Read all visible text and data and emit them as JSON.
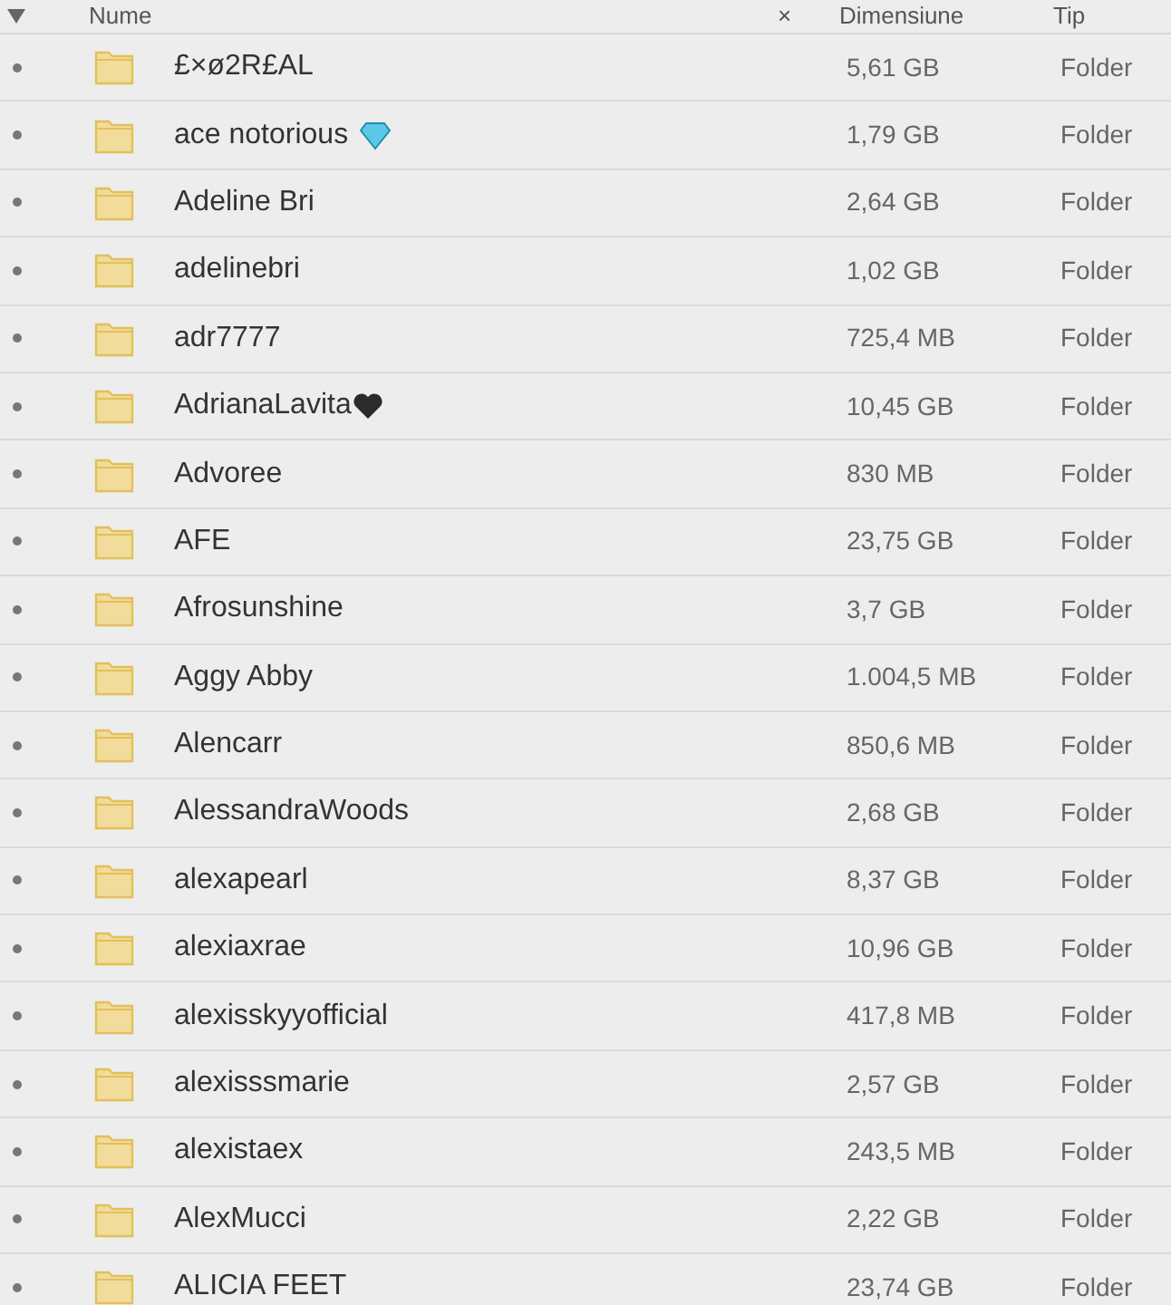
{
  "columns": [
    {
      "label": "Nume"
    },
    {
      "label": "×"
    },
    {
      "label": "Dimensiune"
    },
    {
      "label": "Tip"
    }
  ],
  "rows": [
    {
      "name": "£×ø2R£AL",
      "size": "5,61 GB",
      "type": "Folder"
    },
    {
      "name": "ace notorious",
      "kind": "gem",
      "size": "1,79 GB",
      "type": "Folder"
    },
    {
      "name": "Adeline Bri",
      "size": "2,64 GB",
      "type": "Folder"
    },
    {
      "name": "adelinebri",
      "size": "1,02 GB",
      "type": "Folder"
    },
    {
      "name": "adr7777",
      "size": "725,4 MB",
      "type": "Folder"
    },
    {
      "name": "AdrianaLavita",
      "kind": "heart",
      "size": "10,45 GB",
      "type": "Folder"
    },
    {
      "name": "Advoree",
      "size": "830 MB",
      "type": "Folder"
    },
    {
      "name": "AFE",
      "size": "23,75 GB",
      "type": "Folder"
    },
    {
      "name": "Afrosunshine",
      "size": "3,7 GB",
      "type": "Folder"
    },
    {
      "name": "Aggy Abby",
      "size": "1.004,5 MB",
      "type": "Folder"
    },
    {
      "name": "Alencarr",
      "size": "850,6 MB",
      "type": "Folder"
    },
    {
      "name": "AlessandraWoods",
      "size": "2,68 GB",
      "type": "Folder"
    },
    {
      "name": "alexapearl",
      "size": "8,37 GB",
      "type": "Folder"
    },
    {
      "name": "alexiaxrae",
      "size": "10,96 GB",
      "type": "Folder"
    },
    {
      "name": "alexisskyyofficial",
      "size": "417,8 MB",
      "type": "Folder"
    },
    {
      "name": "alexisssmarie",
      "size": "2,57 GB",
      "type": "Folder"
    },
    {
      "name": "alexistaex",
      "size": "243,5 MB",
      "type": "Folder"
    },
    {
      "name": "AlexMucci",
      "size": "2,22 GB",
      "type": "Folder"
    },
    {
      "name": "ALICIA FEET",
      "size": "23,74 GB",
      "type": "Folder"
    }
  ]
}
